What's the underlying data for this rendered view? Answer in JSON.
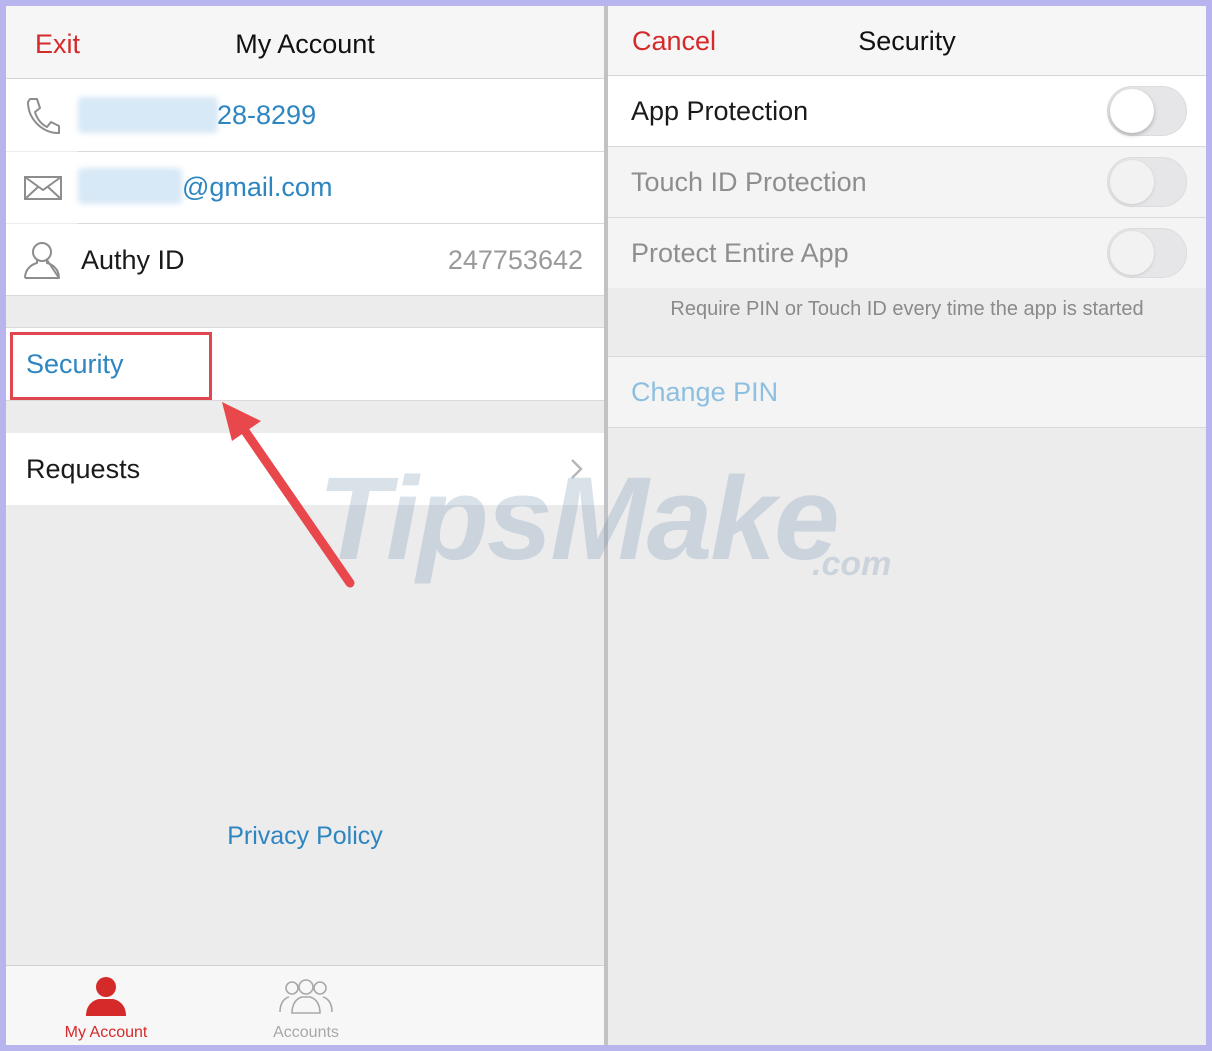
{
  "left": {
    "nav": {
      "exit": "Exit",
      "title": "My Account"
    },
    "phone": {
      "visible": "28-8299",
      "icon": "phone-icon"
    },
    "email": {
      "visible": "@gmail.com",
      "icon": "mail-icon"
    },
    "authy": {
      "label": "Authy ID",
      "value": "247753642",
      "icon": "user-icon"
    },
    "security": "Security",
    "requests": "Requests",
    "privacy": "Privacy Policy",
    "tabs": [
      {
        "label": "My Account",
        "icon": "person-icon",
        "active": true,
        "color": "#d42a2a"
      },
      {
        "label": "Accounts",
        "icon": "group-icon",
        "active": false,
        "color": "#a8a8aa"
      }
    ]
  },
  "right": {
    "nav": {
      "cancel": "Cancel",
      "title": "Security"
    },
    "rows": [
      {
        "label": "App Protection",
        "enabled": false,
        "on": false
      },
      {
        "label": "Touch ID Protection",
        "enabled": false,
        "on": false
      },
      {
        "label": "Protect Entire App",
        "enabled": false,
        "on": false
      }
    ],
    "footnote": "Require PIN or Touch ID every time the app is started",
    "change_pin": "Change PIN"
  },
  "watermark": {
    "main": "TipsMake",
    "suffix": ".com"
  },
  "colors": {
    "accent_red": "#d42a2a",
    "link_blue": "#2e86c1",
    "highlight": "#e0464e"
  }
}
